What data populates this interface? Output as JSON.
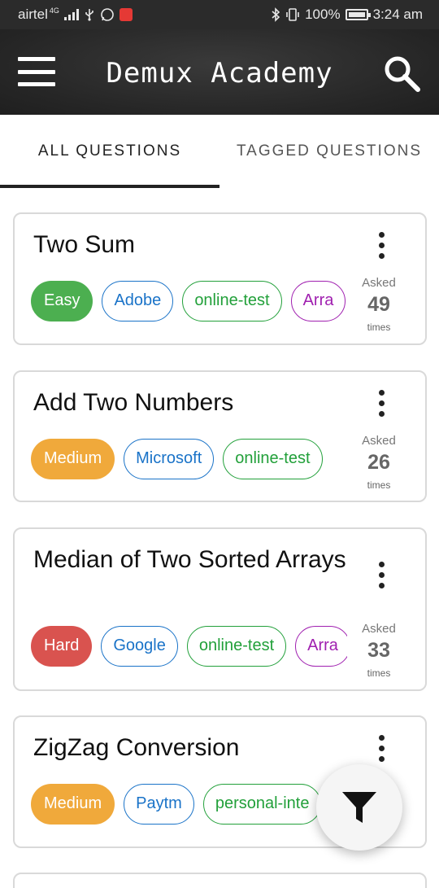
{
  "status_bar": {
    "carrier": "airtel",
    "network": "4G",
    "battery": "100%",
    "time": "3:24 am"
  },
  "toolbar": {
    "title": "Demux Academy",
    "menu_icon": "hamburger-menu-icon",
    "search_icon": "search-icon"
  },
  "tabs": [
    {
      "label": "ALL QUESTIONS",
      "active": true
    },
    {
      "label": "TAGGED QUESTIONS",
      "active": false
    }
  ],
  "questions": [
    {
      "title": "Two Sum",
      "difficulty": "Easy",
      "difficulty_color": "#4caf50",
      "company": "Adobe",
      "tag": "online-test",
      "topic": "Arra",
      "asked_label": "Asked",
      "asked_count": "49",
      "times_label": "times"
    },
    {
      "title": "Add Two Numbers",
      "difficulty": "Medium",
      "difficulty_color": "#f0a93b",
      "company": "Microsoft",
      "tag": "online-test",
      "topic": "",
      "asked_label": "Asked",
      "asked_count": "26",
      "times_label": "times"
    },
    {
      "title": "Median of Two Sorted Arrays",
      "difficulty": "Hard",
      "difficulty_color": "#d9534f",
      "company": "Google",
      "tag": "online-test",
      "topic": "Arra",
      "asked_label": "Asked",
      "asked_count": "33",
      "times_label": "times"
    },
    {
      "title": "ZigZag Conversion",
      "difficulty": "Medium",
      "difficulty_color": "#f0a93b",
      "company": "Paytm",
      "tag": "personal-inte",
      "topic": "",
      "asked_label": "",
      "asked_count": "",
      "times_label": ""
    }
  ],
  "fab": {
    "icon": "filter-icon"
  },
  "colors": {
    "toolbar": "#262626",
    "company_chip": "#1a73c8",
    "tag_chip": "#22a03a",
    "topic_chip": "#a020b0"
  }
}
